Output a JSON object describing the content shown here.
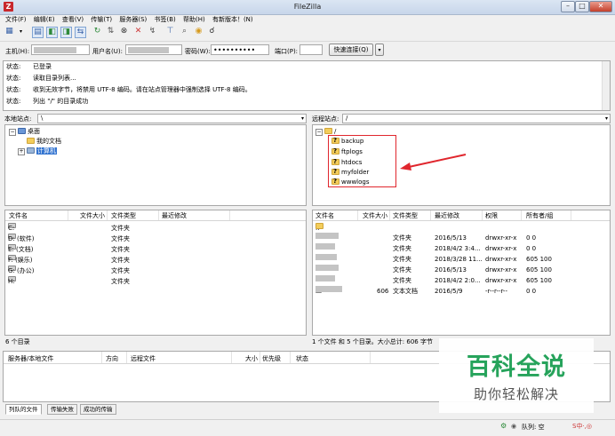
{
  "window": {
    "title": "FileZilla"
  },
  "menu": [
    "文件(F)",
    "编辑(E)",
    "查看(V)",
    "传输(T)",
    "服务器(S)",
    "书签(B)",
    "帮助(H)",
    "有新版本！(N)"
  ],
  "quickconnect": {
    "host_label": "主机(H):",
    "user_label": "用户名(U):",
    "password_label": "密码(W):",
    "password_value": "••••••••••",
    "port_label": "端口(P):",
    "connect_label": "快速连接(Q)"
  },
  "log": [
    {
      "k": "状态:",
      "v": "已登录"
    },
    {
      "k": "状态:",
      "v": "读取目录列表..."
    },
    {
      "k": "状态:",
      "v": "收到无效字节，将禁用 UTF-8 编码。请在站点管理器中强制选择 UTF-8 编码。"
    },
    {
      "k": "状态:",
      "v": "列出 \"/\" 的目录成功"
    }
  ],
  "local": {
    "site_label": "本地站点:",
    "path": "\\",
    "tree": {
      "desktop": "桌面",
      "documents": "我的文档",
      "computer": "计算机"
    },
    "columns": [
      "文件名",
      "文件大小",
      "文件类型",
      "最近修改"
    ],
    "files": [
      {
        "name": "C:",
        "type": "文件夹"
      },
      {
        "name": "D: (软件)",
        "type": "文件夹"
      },
      {
        "name": "E: (文档)",
        "type": "文件夹"
      },
      {
        "name": "F: (娱乐)",
        "type": "文件夹"
      },
      {
        "name": "G: (办公)",
        "type": "文件夹"
      },
      {
        "name": "H:",
        "type": "文件夹"
      }
    ],
    "status": "6 个目录"
  },
  "remote": {
    "site_label": "远程站点:",
    "path": "/",
    "tree_root": "/",
    "tree_folders": [
      "backup",
      "ftplogs",
      "htdocs",
      "myfolder",
      "wwwlogs"
    ],
    "columns": [
      "文件名",
      "文件大小",
      "文件类型",
      "最近修改",
      "权限",
      "所有者/组"
    ],
    "files": [
      {
        "name": "..",
        "size": "",
        "type": "",
        "modified": "",
        "perms": "",
        "owner": ""
      },
      {
        "name": "",
        "size": "",
        "type": "文件夹",
        "modified": "2016/5/13",
        "perms": "drwxr-xr-x",
        "owner": "0 0"
      },
      {
        "name": "",
        "size": "",
        "type": "文件夹",
        "modified": "2018/4/2 3:4...",
        "perms": "drwxr-xr-x",
        "owner": "0 0"
      },
      {
        "name": "",
        "size": "",
        "type": "文件夹",
        "modified": "2018/3/28 11...",
        "perms": "drwxr-xr-x",
        "owner": "605 100"
      },
      {
        "name": "",
        "size": "",
        "type": "文件夹",
        "modified": "2016/5/13",
        "perms": "drwxr-xr-x",
        "owner": "605 100"
      },
      {
        "name": "",
        "size": "",
        "type": "文件夹",
        "modified": "2018/4/2 2:0...",
        "perms": "drwxr-xr-x",
        "owner": "605 100"
      },
      {
        "name": "",
        "size": "606",
        "type": "文本文档",
        "modified": "2016/5/9",
        "perms": "-r--r--r--",
        "owner": "0 0"
      }
    ],
    "status": "1 个文件 和 5 个目录。大小总计: 606 字节"
  },
  "queue": {
    "columns": [
      "服务器/本地文件",
      "方向",
      "远程文件",
      "大小",
      "优先级",
      "状态"
    ],
    "tabs": [
      "列队的文件",
      "传输失败",
      "成功的传输"
    ]
  },
  "statusbar": {
    "queue": "队列: 空"
  },
  "watermark": {
    "line1": "百科全说",
    "line2": "助你轻松解决"
  },
  "colors": {
    "annotation": "#e0262d",
    "folder": "#f3cd5b",
    "watermark_green": "#26a35b"
  }
}
